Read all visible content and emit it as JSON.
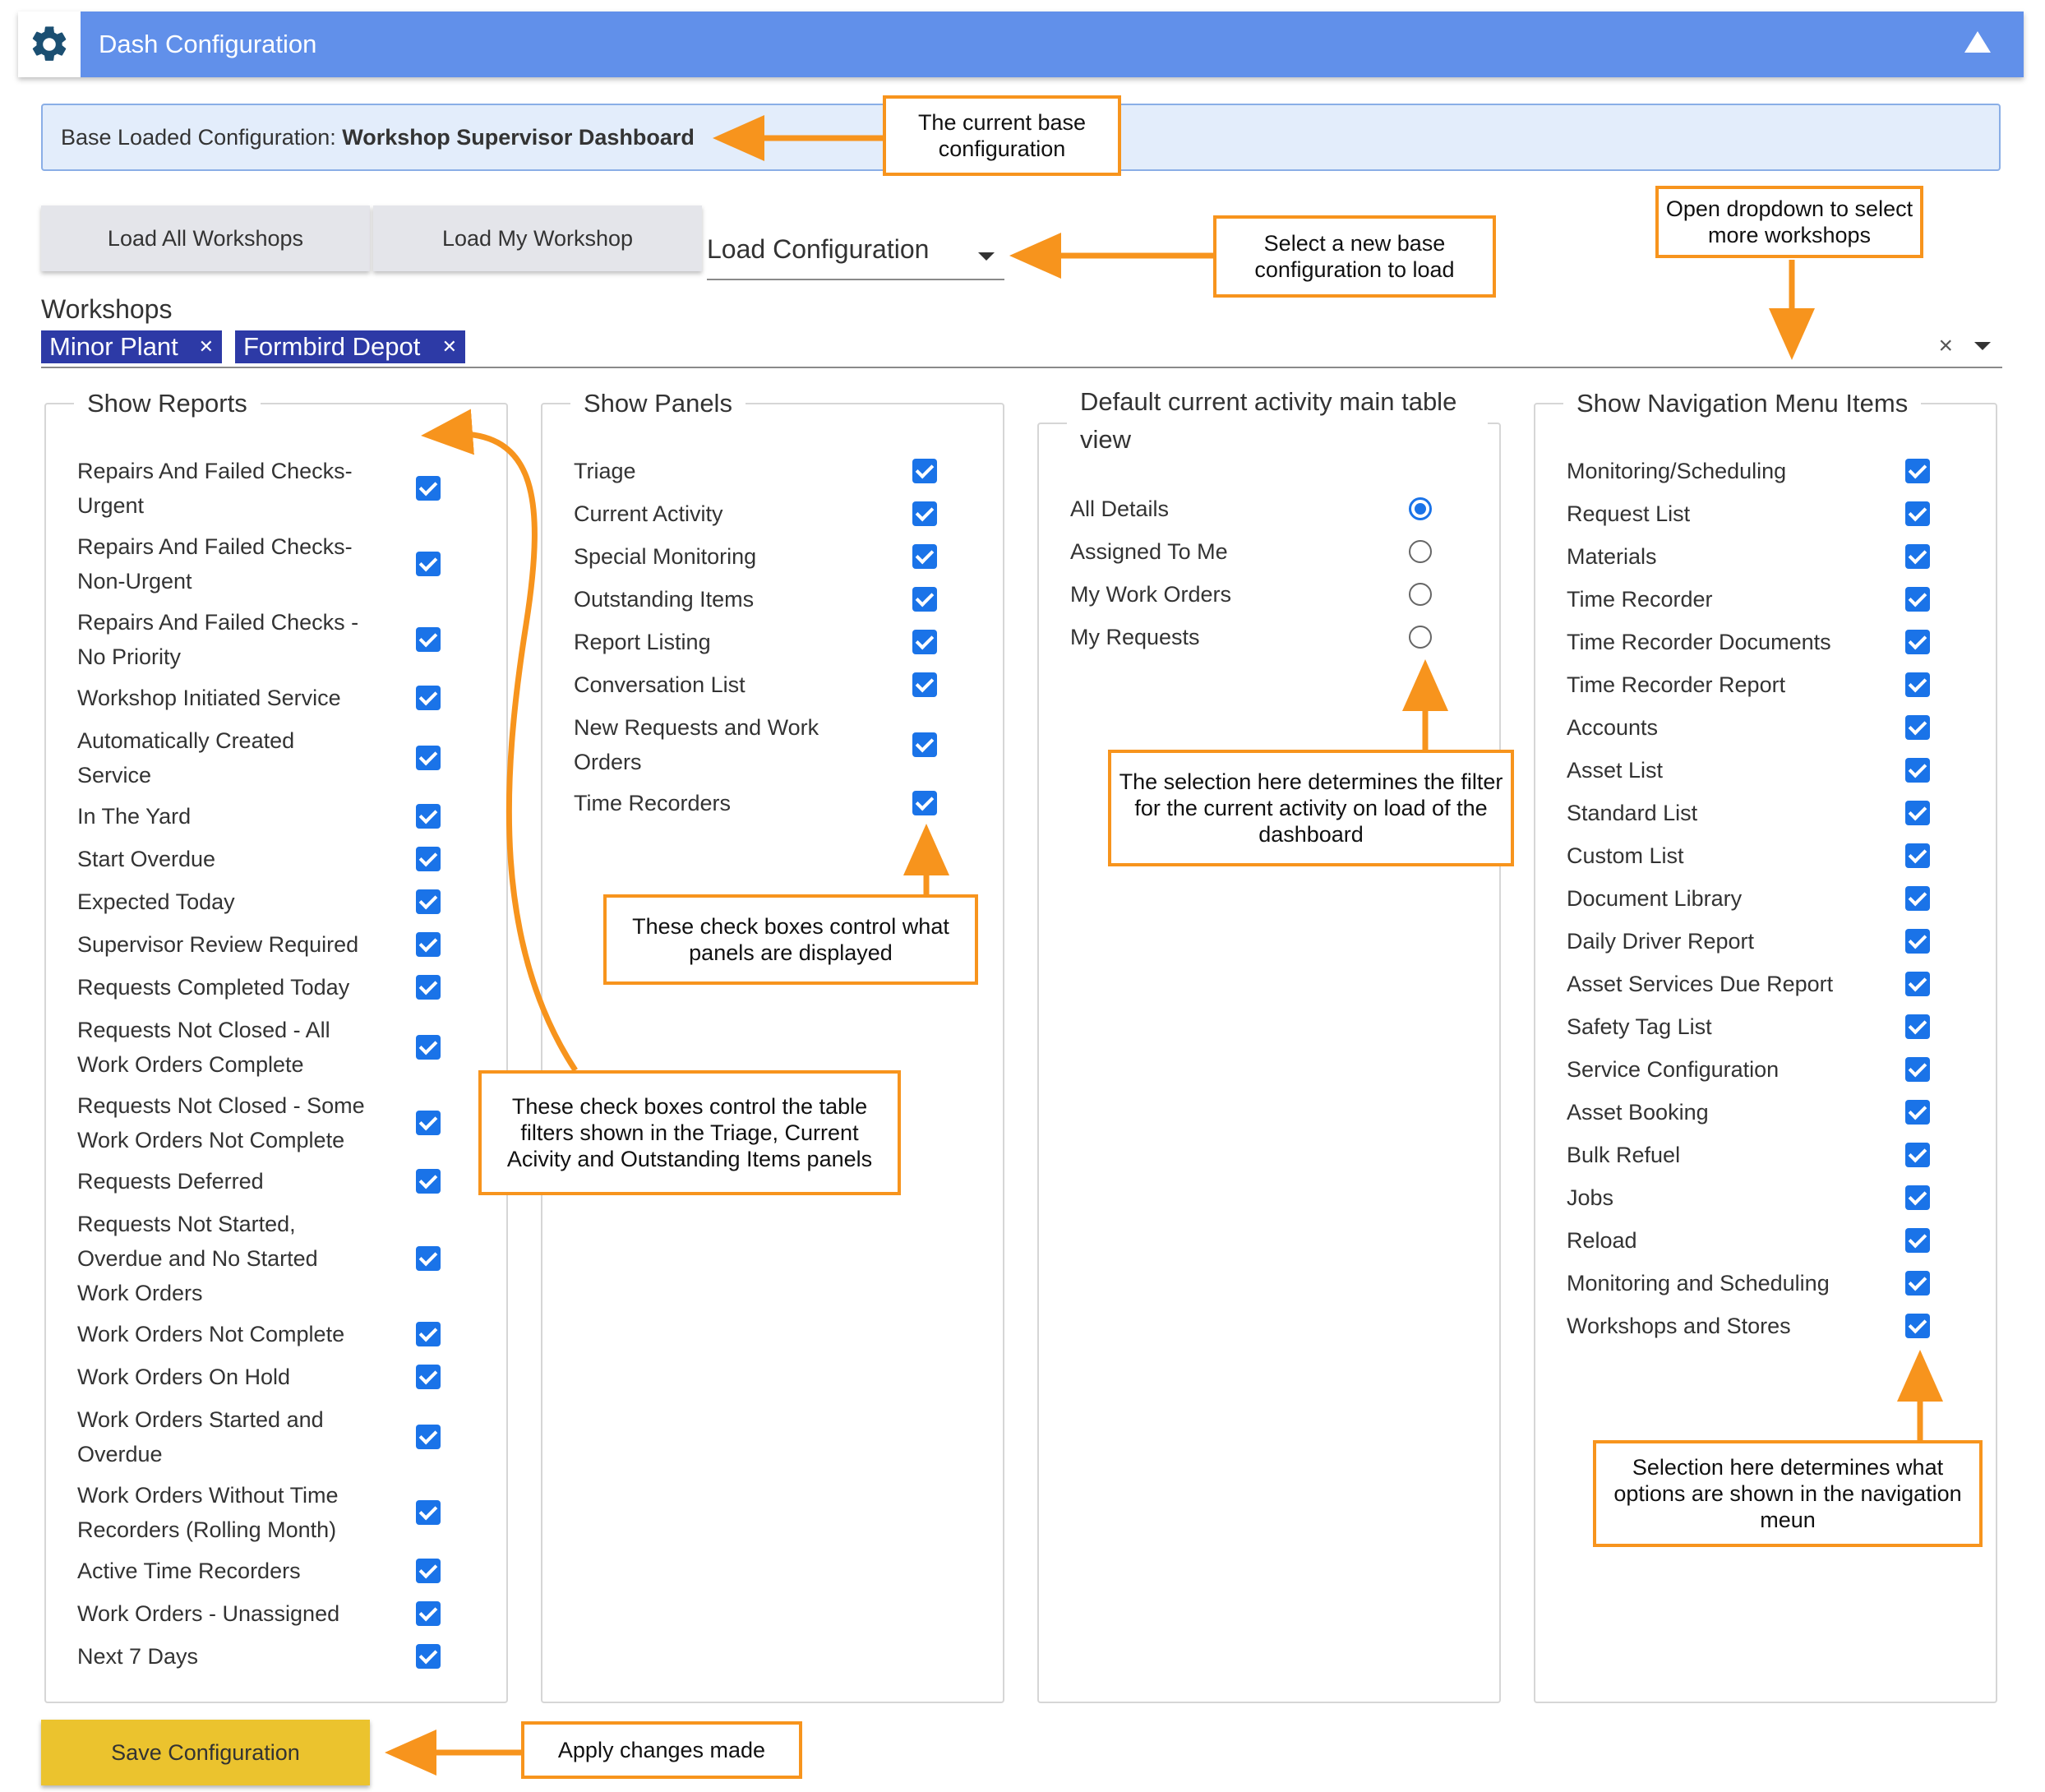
{
  "header": {
    "title": "Dash Configuration",
    "gear_icon": "gear-icon",
    "collapse_icon": "triangle-up-icon",
    "color": "#6190ea"
  },
  "base_config": {
    "label": "Base Loaded Configuration:",
    "value": "Workshop Supervisor Dashboard"
  },
  "buttons": {
    "load_all": "Load All Workshops",
    "load_my": "Load My Workshop",
    "save": "Save Configuration"
  },
  "load_config": {
    "label": "Load Configuration"
  },
  "workshops": {
    "label": "Workshops",
    "chips": [
      "Minor Plant",
      "Formbird Depot"
    ],
    "clear_icon": "×"
  },
  "show_reports": {
    "title": "Show Reports",
    "items": [
      {
        "label": "Repairs And Failed Checks-\nUrgent",
        "checked": true
      },
      {
        "label": "Repairs And Failed Checks-\nNon-Urgent",
        "checked": true
      },
      {
        "label": "Repairs And Failed Checks -\nNo Priority",
        "checked": true
      },
      {
        "label": "Workshop Initiated Service",
        "checked": true
      },
      {
        "label": "Automatically Created\nService",
        "checked": true
      },
      {
        "label": "In The Yard",
        "checked": true
      },
      {
        "label": "Start Overdue",
        "checked": true
      },
      {
        "label": "Expected Today",
        "checked": true
      },
      {
        "label": "Supervisor Review Required",
        "checked": true
      },
      {
        "label": "Requests Completed Today",
        "checked": true
      },
      {
        "label": "Requests Not Closed - All\nWork Orders Complete",
        "checked": true
      },
      {
        "label": "Requests Not Closed - Some\nWork Orders Not Complete",
        "checked": true
      },
      {
        "label": "Requests Deferred",
        "checked": true
      },
      {
        "label": "Requests Not Started,\nOverdue and No Started\nWork Orders",
        "checked": true
      },
      {
        "label": "Work Orders Not Complete",
        "checked": true
      },
      {
        "label": "Work Orders On Hold",
        "checked": true
      },
      {
        "label": "Work Orders Started and\nOverdue",
        "checked": true
      },
      {
        "label": "Work Orders Without Time\nRecorders (Rolling Month)",
        "checked": true
      },
      {
        "label": "Active Time Recorders",
        "checked": true
      },
      {
        "label": "Work Orders - Unassigned",
        "checked": true
      },
      {
        "label": "Next 7 Days",
        "checked": true
      }
    ]
  },
  "show_panels": {
    "title": "Show Panels",
    "items": [
      {
        "label": "Triage",
        "checked": true
      },
      {
        "label": "Current Activity",
        "checked": true
      },
      {
        "label": "Special Monitoring",
        "checked": true
      },
      {
        "label": "Outstanding Items",
        "checked": true
      },
      {
        "label": "Report Listing",
        "checked": true
      },
      {
        "label": "Conversation List",
        "checked": true
      },
      {
        "label": "New Requests and Work\nOrders",
        "checked": true
      },
      {
        "label": "Time Recorders",
        "checked": true
      }
    ]
  },
  "default_view": {
    "title": "Default current activity main table\nview",
    "options": [
      {
        "label": "All Details",
        "selected": true
      },
      {
        "label": "Assigned To Me",
        "selected": false
      },
      {
        "label": "My Work Orders",
        "selected": false
      },
      {
        "label": "My Requests",
        "selected": false
      }
    ]
  },
  "show_nav": {
    "title": "Show Navigation Menu Items",
    "items": [
      {
        "label": "Monitoring/Scheduling",
        "checked": true
      },
      {
        "label": "Request List",
        "checked": true
      },
      {
        "label": "Materials",
        "checked": true
      },
      {
        "label": "Time Recorder",
        "checked": true
      },
      {
        "label": "Time Recorder Documents",
        "checked": true
      },
      {
        "label": "Time Recorder Report",
        "checked": true
      },
      {
        "label": "Accounts",
        "checked": true
      },
      {
        "label": "Asset List",
        "checked": true
      },
      {
        "label": "Standard List",
        "checked": true
      },
      {
        "label": "Custom List",
        "checked": true
      },
      {
        "label": "Document Library",
        "checked": true
      },
      {
        "label": "Daily Driver Report",
        "checked": true
      },
      {
        "label": "Asset Services Due Report",
        "checked": true
      },
      {
        "label": "Safety Tag List",
        "checked": true
      },
      {
        "label": "Service Configuration",
        "checked": true
      },
      {
        "label": "Asset Booking",
        "checked": true
      },
      {
        "label": "Bulk Refuel",
        "checked": true
      },
      {
        "label": "Jobs",
        "checked": true
      },
      {
        "label": "Reload",
        "checked": true
      },
      {
        "label": "Monitoring and Scheduling",
        "checked": true
      },
      {
        "label": "Workshops and Stores",
        "checked": true
      }
    ]
  },
  "callouts": {
    "base": "The current base\nconfiguration",
    "load": "Select a new base\nconfiguration to load",
    "dropdown": "Open dropdown to select\nmore workshops",
    "reports": "These check boxes control the table\nfilters shown in the Triage, Current\nAcivity and Outstanding Items panels",
    "panels": "These check boxes control what\npanels are displayed",
    "default": "The selection here determines the filter\nfor the current activity on load of the\ndashboard",
    "nav": "Selection here determines what\noptions are shown in the navigation\nmeun",
    "save": "Apply changes made"
  },
  "colors": {
    "accent": "#1a73e8",
    "callout_border": "#f7941d",
    "save": "#ebc32e",
    "chip": "#2d3aa6"
  }
}
